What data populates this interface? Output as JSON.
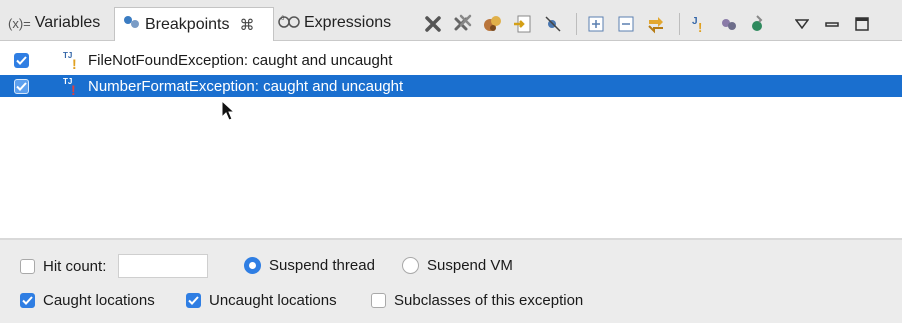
{
  "tabs": [
    {
      "prefix": "(x)=",
      "label": "Variables"
    },
    {
      "label": "Breakpoints",
      "close": "⌘"
    },
    {
      "label": "Expressions"
    }
  ],
  "toolbar_icons": [
    "remove-icon",
    "remove-all-icon",
    "link-with-debug-icon",
    "go-to-file-icon",
    "skip-breakpoints-icon",
    "expand-all-icon",
    "collapse-all-icon",
    "link-icon",
    "java-exception-breakpoint-icon",
    "group-icon",
    "breakpoint-types-icon",
    "view-menu-icon",
    "minimize-icon",
    "maximize-icon"
  ],
  "breakpoints": [
    {
      "text": "FileNotFoundException: caught and uncaught",
      "checked": true,
      "selected": false
    },
    {
      "text": "NumberFormatException: caught and uncaught",
      "checked": true,
      "selected": true
    }
  ],
  "options": {
    "hit_count_label": "Hit count:",
    "hit_count_value": "",
    "suspend_thread_label": "Suspend thread",
    "suspend_vm_label": "Suspend VM",
    "caught_label": "Caught locations",
    "uncaught_label": "Uncaught locations",
    "subclasses_label": "Subclasses of this exception"
  },
  "colors": {
    "selection": "#1a6fcf",
    "accent": "#2f7ee3"
  }
}
